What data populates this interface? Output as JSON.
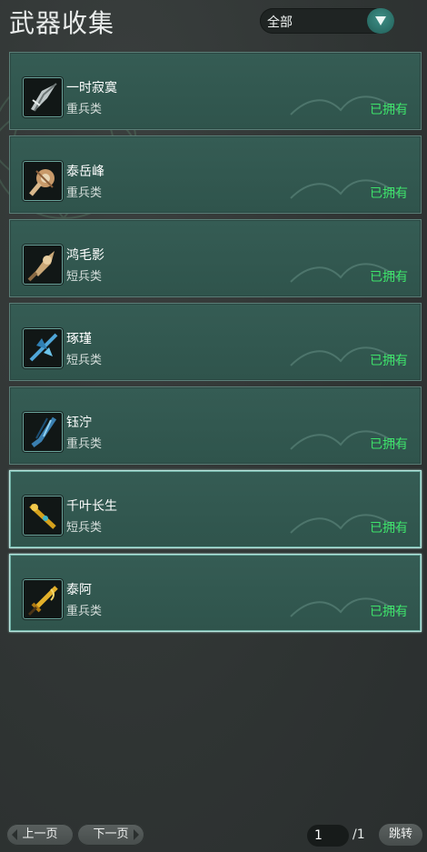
{
  "header": {
    "title": "武器收集"
  },
  "filter": {
    "selected": "全部"
  },
  "weapons": [
    {
      "name": "一时寂寞",
      "type": "重兵类",
      "status": "已拥有",
      "icon": "spear-tip-icon"
    },
    {
      "name": "泰岳峰",
      "type": "重兵类",
      "status": "已拥有",
      "icon": "mace-head-icon"
    },
    {
      "name": "鸿毛影",
      "type": "短兵类",
      "status": "已拥有",
      "icon": "ornate-dagger-icon"
    },
    {
      "name": "琢瑾",
      "type": "短兵类",
      "status": "已拥有",
      "icon": "blue-blade-icon"
    },
    {
      "name": "钰泞",
      "type": "重兵类",
      "status": "已拥有",
      "icon": "crystal-blade-icon"
    },
    {
      "name": "千叶长生",
      "type": "短兵类",
      "status": "已拥有",
      "icon": "golden-staff-icon"
    },
    {
      "name": "泰阿",
      "type": "重兵类",
      "status": "已拥有",
      "icon": "golden-sword-icon"
    }
  ],
  "pagination": {
    "prev_label": "上一页",
    "next_label": "下一页",
    "current_page": "1",
    "total_pages": "/1",
    "jump_label": "跳转"
  },
  "colors": {
    "card_bg": "#355c54",
    "owned_status": "#3ee36b",
    "selected_border": "#b6e4dc"
  }
}
